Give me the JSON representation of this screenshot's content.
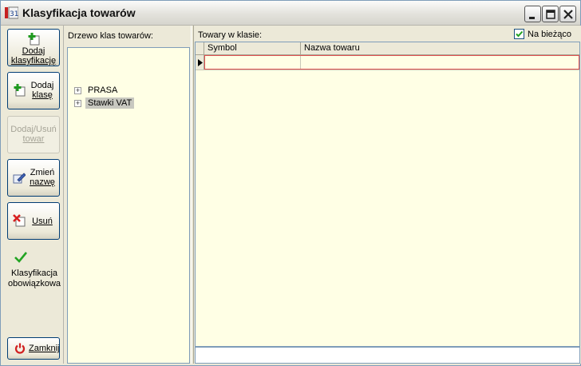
{
  "window": {
    "title": "Klasyfikacja towarów"
  },
  "toolbar": {
    "add_classification": [
      "Dodaj",
      "klasyfikację"
    ],
    "add_class": [
      "Dodaj",
      "klasę"
    ],
    "add_remove_goods": [
      "Dodaj/Usuń",
      "towar"
    ],
    "rename": [
      "Zmień",
      "nazwę"
    ],
    "remove": "Usuń",
    "mandatory": [
      "Klasyfikacja",
      "obowiązkowa"
    ],
    "close": "Zamknij"
  },
  "tree": {
    "heading": "Drzewo klas towarów:",
    "items": [
      {
        "label": "PRASA",
        "selected": false
      },
      {
        "label": "Stawki VAT",
        "selected": true
      }
    ]
  },
  "goods": {
    "heading": "Towary w klasie:",
    "current_label": "Na bieżąco",
    "current_checked": true,
    "columns": [
      "Symbol",
      "Nazwa towaru"
    ]
  },
  "colors": {
    "panel_bg": "#ffffe5",
    "selection_border": "#e05050",
    "chrome": "#ece9d8"
  }
}
